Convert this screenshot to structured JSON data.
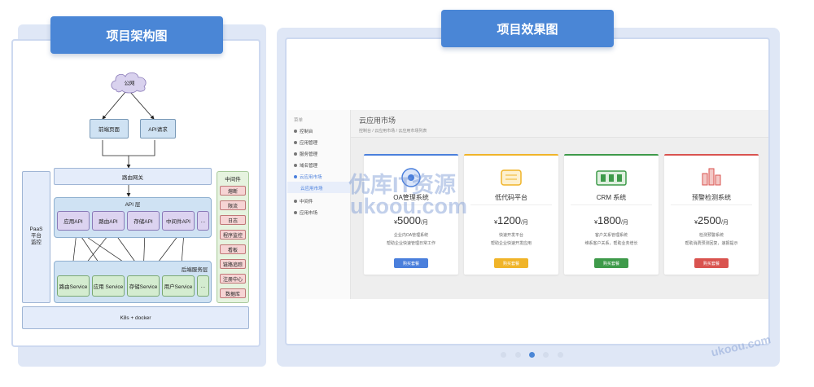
{
  "left_panel": {
    "title": "项目架构图",
    "diagram": {
      "internet": "公网",
      "frontend": "前端页面",
      "api_request": "API请求",
      "gateway": "路由网关",
      "paas_monitor": "PaaS\n平台\n监控",
      "api_layer": "API 层",
      "apis": [
        "应用API",
        "路由API",
        "存储API",
        "中间件API",
        "..."
      ],
      "backend_layer": "后端服务层",
      "services": [
        "路由Service",
        "应用 Service",
        "存储Service",
        "用户Service",
        "..."
      ],
      "infra": "K8s + docker",
      "middleware_title": "中间件",
      "middleware": [
        "熔断",
        "限流",
        "日志",
        "程序监控",
        "看板",
        "链路追踪",
        "注册中心",
        "数据库"
      ]
    }
  },
  "right_panel": {
    "title": "项目效果图",
    "screenshot": {
      "sidebar_header": "菜单",
      "sidebar": [
        "控制台",
        "应用管理",
        "服务管理",
        "域名管理",
        "云应用市场",
        "云应用市场",
        "中间件",
        "应用市场"
      ],
      "page_title": "云应用市场",
      "breadcrumb": "控制台 / 云应用市场 / 云应用市场列表",
      "products": [
        {
          "name": "OA管理系统",
          "price": "5000",
          "unit": "/月",
          "desc1": "企业内OA管理系统",
          "desc2": "帮助企业快速管理日常工作",
          "btn": "购买套餐",
          "color": "#4a7fdc"
        },
        {
          "name": "低代码平台",
          "price": "1200",
          "unit": "/月",
          "desc1": "快速开发平台",
          "desc2": "帮助企业快速开发应用",
          "btn": "购买套餐",
          "color": "#f0b429"
        },
        {
          "name": "CRM 系统",
          "price": "1800",
          "unit": "/月",
          "desc1": "客户关系管理系统",
          "desc2": "维系客户关系，帮助业务增长",
          "btn": "购买套餐",
          "color": "#3e9a4a"
        },
        {
          "name": "预警检测系统",
          "price": "2500",
          "unit": "/月",
          "desc1": "检测预警系统",
          "desc2": "帮助消费预测回复，速报提示",
          "btn": "购买套餐",
          "color": "#d9534f"
        }
      ]
    },
    "carousel_dots": 5,
    "active_dot": 2
  },
  "watermark": {
    "line1": "优库IT资源",
    "line2": "ukoou.com",
    "corner": "ukoou.com"
  }
}
